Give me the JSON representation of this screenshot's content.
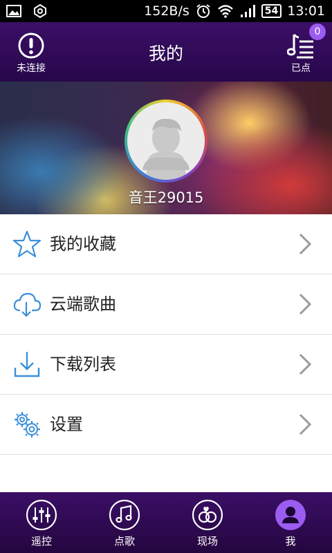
{
  "status_bar": {
    "net_speed": "152B/s",
    "battery": "54",
    "time": "13:01"
  },
  "header": {
    "title": "我的",
    "left_caption": "未连接",
    "right_caption": "已点",
    "badge_count": "0"
  },
  "profile": {
    "username": "音王29015"
  },
  "menu": {
    "items": [
      {
        "label": "我的收藏",
        "icon": "star-icon"
      },
      {
        "label": "云端歌曲",
        "icon": "cloud-download-icon"
      },
      {
        "label": "下载列表",
        "icon": "download-icon"
      },
      {
        "label": "设置",
        "icon": "gear-icon"
      }
    ]
  },
  "tabbar": {
    "tabs": [
      {
        "label": "遥控",
        "icon": "sliders-icon"
      },
      {
        "label": "点歌",
        "icon": "music-note-icon"
      },
      {
        "label": "现场",
        "icon": "rings-icon"
      },
      {
        "label": "我",
        "icon": "user-icon",
        "active": true
      }
    ]
  },
  "colors": {
    "header_bg": "#3b0f66",
    "icon_accent": "#3a8fd8",
    "badge": "#9b5cf0",
    "active_tab": "#9b5cf0"
  }
}
